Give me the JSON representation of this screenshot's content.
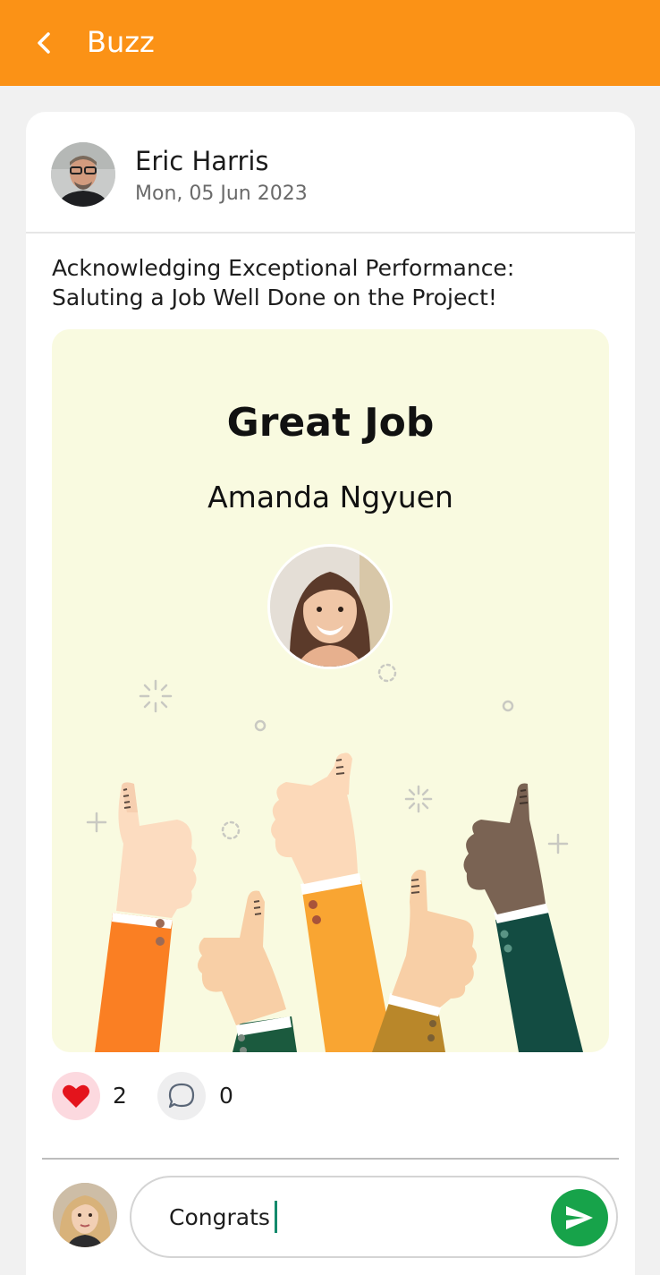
{
  "app_bar": {
    "title": "Buzz",
    "back_icon": "chevron-left-icon",
    "color": "#fb9216"
  },
  "post": {
    "author_name": "Eric Harris",
    "date": "Mon, 05 Jun 2023",
    "text": "Acknowledging Exceptional Performance: Saluting a Job Well Done on the Project!",
    "kudos_card": {
      "title": "Great Job",
      "recipient_name": "Amanda Ngyuen",
      "background": "#f9fae0"
    },
    "reactions": {
      "like_icon": "heart-icon",
      "like_count": "2",
      "comment_icon": "comment-bubble-icon",
      "comment_count": "0"
    }
  },
  "composer": {
    "value": "Congrats",
    "send_icon": "send-icon",
    "send_color": "#17a34a"
  }
}
